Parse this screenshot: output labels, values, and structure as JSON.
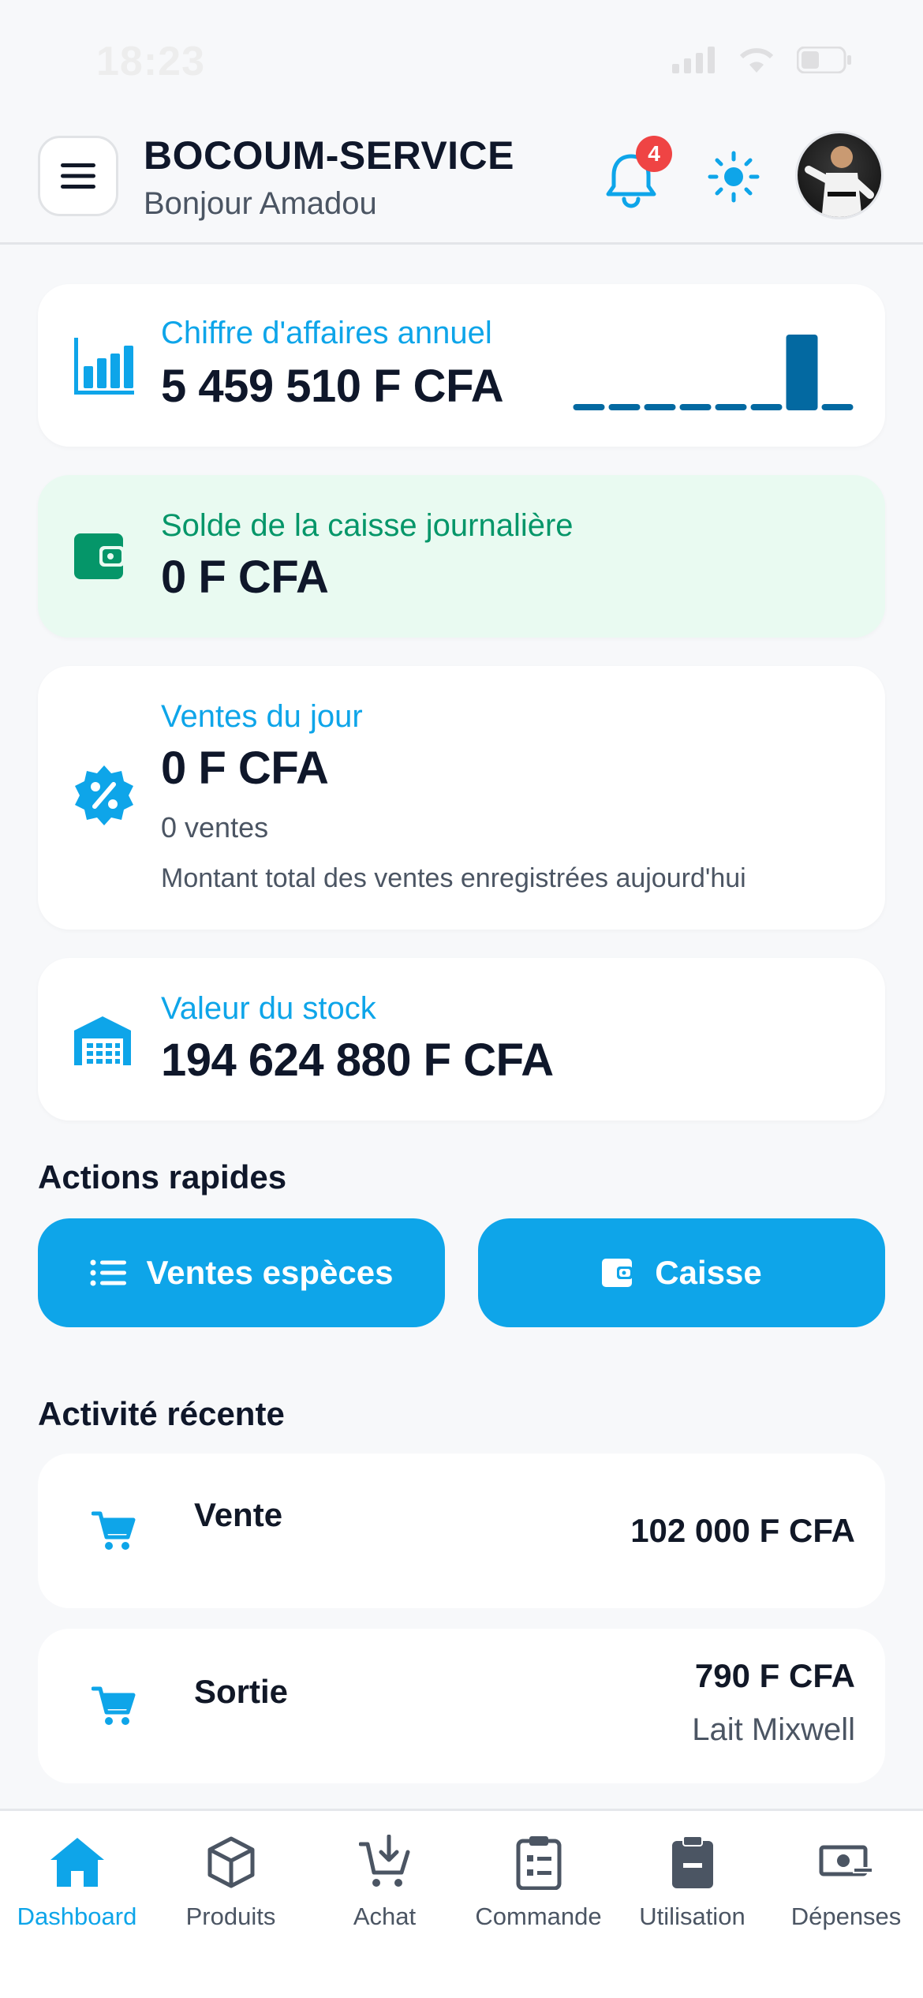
{
  "status_bar": {
    "time": "18:23"
  },
  "header": {
    "brand": "BOCOUM-SERVICE",
    "greeting": "Bonjour Amadou",
    "notification_count": "4"
  },
  "cards": {
    "annual_revenue": {
      "label": "Chiffre d'affaires annuel",
      "value": "5 459 510 F CFA",
      "sparkline": [
        0,
        0,
        0,
        0,
        0,
        0,
        1,
        0
      ]
    },
    "daily_cash": {
      "label": "Solde de la caisse journalière",
      "value": "0 F CFA"
    },
    "daily_sales": {
      "label": "Ventes du jour",
      "value": "0 F CFA",
      "count": "0 ventes",
      "description": "Montant total des ventes enregistrées aujourd'hui"
    },
    "stock_value": {
      "label": "Valeur du stock",
      "value": "194 624 880 F CFA"
    }
  },
  "quick_actions": {
    "title": "Actions rapides",
    "cash_sales": "Ventes espèces",
    "cashier": "Caisse"
  },
  "recent_activity": {
    "title": "Activité récente",
    "items": [
      {
        "title": "Vente",
        "amount": "102 000 F CFA",
        "detail": ""
      },
      {
        "title": "Sortie",
        "amount": "790 F CFA",
        "detail": "Lait Mixwell"
      }
    ]
  },
  "nav": {
    "dashboard": "Dashboard",
    "products": "Produits",
    "purchase": "Achat",
    "order": "Commande",
    "usage": "Utilisation",
    "expenses": "Dépenses"
  },
  "colors": {
    "accent": "#0ea5e9",
    "success": "#059669",
    "success_bg": "#e9faf1",
    "badge": "#ef4444",
    "spark": "#0369a1"
  }
}
